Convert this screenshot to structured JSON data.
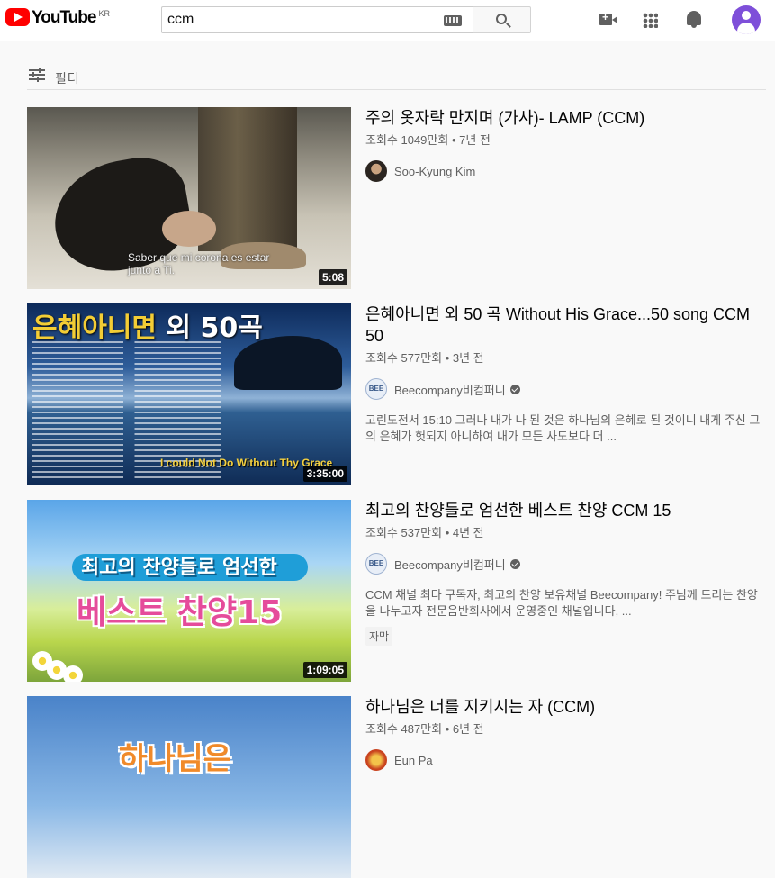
{
  "header": {
    "logo_text": "YouTube",
    "logo_region": "KR",
    "search_value": "ccm"
  },
  "filter": {
    "label": "필터"
  },
  "results": [
    {
      "title": "주의 옷자락 만지며 (가사)- LAMP (CCM)",
      "meta": "조회수 1049만회 • 7년 전",
      "channel": "Soo-Kyung Kim",
      "verified": false,
      "duration": "5:08",
      "thumb_caption": "Saber que mi corona es estar junto a Ti."
    },
    {
      "title": "은혜아니면 외 50 곡 Without His Grace...50 song CCM 50",
      "meta": "조회수 577만회 • 3년 전",
      "channel": "Beecompany비컴퍼니",
      "verified": true,
      "description": "고린도전서 15:10 그러나 내가 나 된 것은 하나님의 은혜로 된 것이니 내게 주신 그의 은혜가 헛되지 아니하여 내가 모든 사도보다 더 ...",
      "duration": "3:35:00",
      "thumb_title_a": "은혜아니면",
      "thumb_title_b": " 외 50곡",
      "thumb_caption": "I could Not Do Without Thy Grace"
    },
    {
      "title": "최고의 찬양들로 엄선한 베스트 찬양 CCM 15",
      "meta": "조회수 537만회 • 4년 전",
      "channel": "Beecompany비컴퍼니",
      "verified": true,
      "description": "CCM 채널 최다 구독자, 최고의 찬양 보유채널 Beecompany! 주님께 드리는 찬양을 나누고자 전문음반회사에서 운영중인 채널입니다, ...",
      "badge": "자막",
      "duration": "1:09:05",
      "thumb_banner": "최고의 찬양들로 엄선한",
      "thumb_big": "베스트 찬양15"
    },
    {
      "title": "하나님은 너를 지키시는 자 (CCM)",
      "meta": "조회수 487만회 • 6년 전",
      "channel": "Eun Pa",
      "verified": false,
      "thumb_big": "하나님은"
    }
  ],
  "colors": {
    "accent": "#ff0000",
    "avatar": "#7e4fd9",
    "secondary_text": "#606060"
  }
}
